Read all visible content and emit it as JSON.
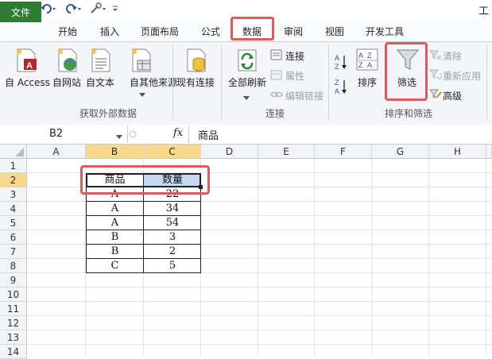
{
  "window": {
    "title_fragment": "工"
  },
  "quick_access": {
    "icons": [
      "save-icon",
      "undo-icon",
      "redo-icon",
      "customize-icon"
    ]
  },
  "tabs": {
    "file": "文件",
    "items": [
      "开始",
      "插入",
      "页面布局",
      "公式",
      "数据",
      "审阅",
      "视图",
      "开发工具"
    ],
    "active": "数据"
  },
  "ribbon": {
    "get_external": {
      "title": "获取外部数据",
      "access": "自 Access",
      "web": "自网站",
      "text": "自文本",
      "other": "自其他来源",
      "existing": "现有连接"
    },
    "connections": {
      "title": "连接",
      "refresh_all": "全部刷新",
      "connections": "连接",
      "properties": "属性",
      "edit_links": "编辑链接"
    },
    "sort_filter": {
      "title": "排序和筛选",
      "sort": "排序",
      "filter": "筛选",
      "clear": "清除",
      "reapply": "重新应用",
      "advanced": "高级"
    }
  },
  "formula_bar": {
    "name_box": "B2",
    "fx": "fx",
    "content": "商品"
  },
  "sheet": {
    "columns": [
      "A",
      "B",
      "C",
      "D",
      "E",
      "F",
      "G",
      "H"
    ],
    "rows": [
      "1",
      "2",
      "3",
      "4",
      "5",
      "6",
      "7",
      "8",
      "9",
      "10",
      "11",
      "12",
      "13",
      "14"
    ],
    "table": {
      "headers": [
        "商品",
        "数量"
      ],
      "rows": [
        [
          "A",
          "22"
        ],
        [
          "A",
          "34"
        ],
        [
          "A",
          "54"
        ],
        [
          "B",
          "3"
        ],
        [
          "B",
          "2"
        ],
        [
          "C",
          "5"
        ]
      ]
    }
  }
}
